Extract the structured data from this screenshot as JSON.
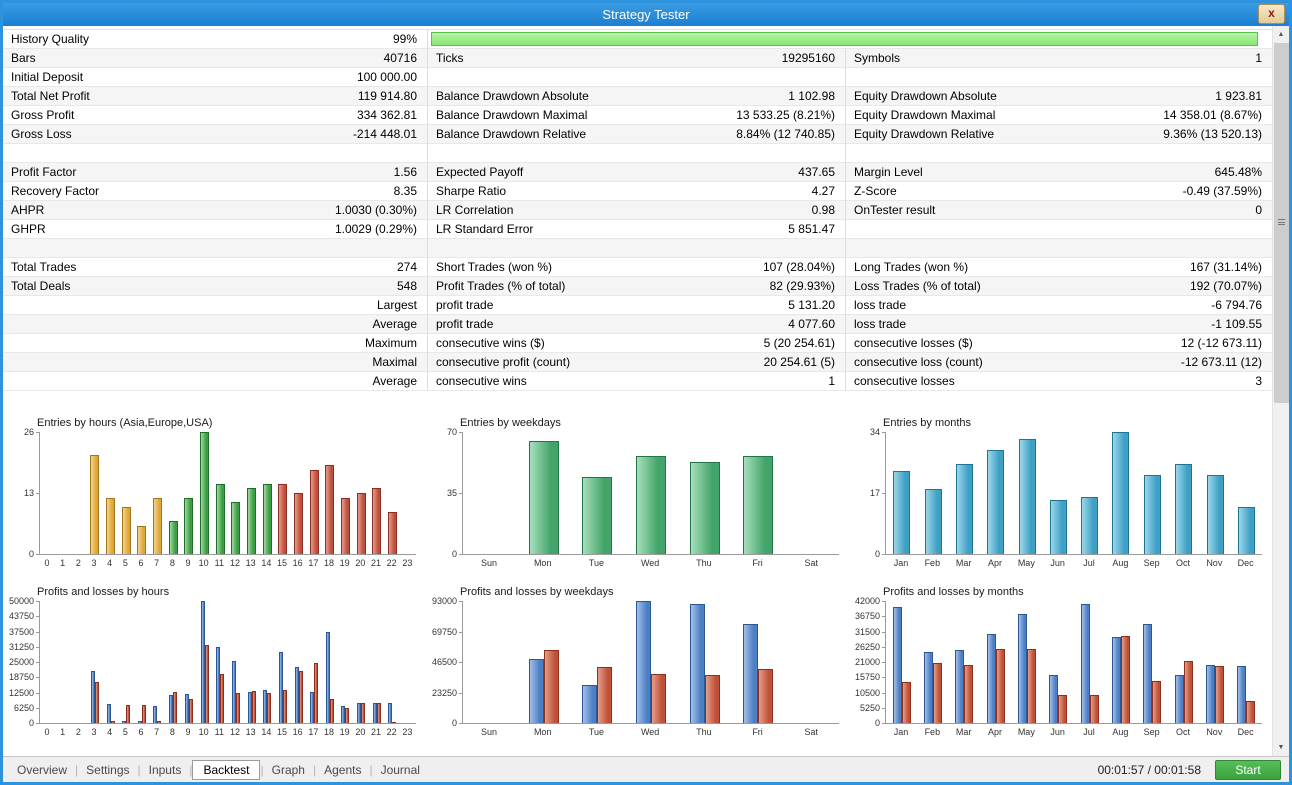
{
  "window": {
    "title": "Strategy Tester",
    "close_glyph": "x"
  },
  "scrollbar": {
    "up": "▲",
    "down": "▼"
  },
  "stats": {
    "rows": [
      {
        "cells": [
          "History Quality",
          "99%",
          "",
          "",
          "",
          ""
        ],
        "progress": 99
      },
      {
        "cells": [
          "Bars",
          "40716",
          "Ticks",
          "19295160",
          "Symbols",
          "1"
        ]
      },
      {
        "cells": [
          "Initial Deposit",
          "100 000.00",
          "",
          "",
          "",
          ""
        ]
      },
      {
        "cells": [
          "Total Net Profit",
          "119 914.80",
          "Balance Drawdown Absolute",
          "1 102.98",
          "Equity Drawdown Absolute",
          "1 923.81"
        ]
      },
      {
        "cells": [
          "Gross Profit",
          "334 362.81",
          "Balance Drawdown Maximal",
          "13 533.25 (8.21%)",
          "Equity Drawdown Maximal",
          "14 358.01 (8.67%)"
        ]
      },
      {
        "cells": [
          "Gross Loss",
          "-214 448.01",
          "Balance Drawdown Relative",
          "8.84% (12 740.85)",
          "Equity Drawdown Relative",
          "9.36% (13 520.13)"
        ]
      },
      {
        "cells": [
          "",
          "",
          "",
          "",
          "",
          ""
        ]
      },
      {
        "cells": [
          "Profit Factor",
          "1.56",
          "Expected Payoff",
          "437.65",
          "Margin Level",
          "645.48%"
        ]
      },
      {
        "cells": [
          "Recovery Factor",
          "8.35",
          "Sharpe Ratio",
          "4.27",
          "Z-Score",
          "-0.49 (37.59%)"
        ]
      },
      {
        "cells": [
          "AHPR",
          "1.0030 (0.30%)",
          "LR Correlation",
          "0.98",
          "OnTester result",
          "0"
        ]
      },
      {
        "cells": [
          "GHPR",
          "1.0029 (0.29%)",
          "LR Standard Error",
          "5 851.47",
          "",
          ""
        ]
      },
      {
        "cells": [
          "",
          "",
          "",
          "",
          "",
          ""
        ]
      },
      {
        "cells": [
          "Total Trades",
          "274",
          "Short Trades (won %)",
          "107 (28.04%)",
          "Long Trades (won %)",
          "167 (31.14%)"
        ]
      },
      {
        "cells": [
          "Total Deals",
          "548",
          "Profit Trades (% of total)",
          "82 (29.93%)",
          "Loss Trades (% of total)",
          "192 (70.07%)"
        ]
      },
      {
        "cells": [
          "",
          "Largest",
          "profit trade",
          "5 131.20",
          "loss trade",
          "-6 794.76"
        ]
      },
      {
        "cells": [
          "",
          "Average",
          "profit trade",
          "4 077.60",
          "loss trade",
          "-1 109.55"
        ]
      },
      {
        "cells": [
          "",
          "Maximum",
          "consecutive wins ($)",
          "5 (20 254.61)",
          "consecutive losses ($)",
          "12 (-12 673.11)"
        ]
      },
      {
        "cells": [
          "",
          "Maximal",
          "consecutive profit (count)",
          "20 254.61 (5)",
          "consecutive loss (count)",
          "-12 673.11 (12)"
        ]
      },
      {
        "cells": [
          "",
          "Average",
          "consecutive wins",
          "1",
          "consecutive losses",
          "3"
        ]
      }
    ]
  },
  "palette": {
    "asia": {
      "base": "#dfa63a",
      "light": "#f3d38e",
      "dark": "#a3761c"
    },
    "europe": {
      "base": "#3c9d44",
      "light": "#9fd9a0",
      "dark": "#1f6f28"
    },
    "usa": {
      "base": "#bf4f3c",
      "light": "#e39c8c",
      "dark": "#8c2f20"
    },
    "green": {
      "base": "#43a469",
      "light": "#a7dfbb",
      "dark": "#23744a"
    },
    "blue": {
      "base": "#3ea0c6",
      "light": "#9bd7e8",
      "dark": "#1f7494"
    },
    "profit": {
      "base": "#4d7fc4",
      "light": "#a3bfe8",
      "dark": "#2c5795"
    },
    "loss": {
      "base": "#c05138",
      "light": "#e49e8a",
      "dark": "#8e2f1c"
    }
  },
  "chart_data": [
    {
      "type": "bar",
      "title": "Entries by hours (Asia,Europe,USA)",
      "categories": [
        "0",
        "1",
        "2",
        "3",
        "4",
        "5",
        "6",
        "7",
        "8",
        "9",
        "10",
        "11",
        "12",
        "13",
        "14",
        "15",
        "16",
        "17",
        "18",
        "19",
        "20",
        "21",
        "22",
        "23"
      ],
      "values": [
        0,
        0,
        0,
        21,
        12,
        10,
        6,
        12,
        7,
        12,
        26,
        15,
        11,
        14,
        15,
        15,
        13,
        18,
        19,
        12,
        13,
        14,
        9,
        0
      ],
      "bar_colors": [
        "",
        "",
        "",
        "asia",
        "asia",
        "asia",
        "asia",
        "asia",
        "europe",
        "europe",
        "europe",
        "europe",
        "europe",
        "europe",
        "europe",
        "usa",
        "usa",
        "usa",
        "usa",
        "usa",
        "usa",
        "usa",
        "usa",
        ""
      ],
      "yticks": [
        0,
        13,
        26
      ],
      "ylim": [
        0,
        26
      ],
      "xlabel": "",
      "ylabel": ""
    },
    {
      "type": "bar",
      "title": "Entries by weekdays",
      "categories": [
        "Sun",
        "Mon",
        "Tue",
        "Wed",
        "Thu",
        "Fri",
        "Sat"
      ],
      "values": [
        0,
        65,
        44,
        56,
        53,
        56,
        0
      ],
      "color": "green",
      "yticks": [
        0,
        35,
        70
      ],
      "ylim": [
        0,
        70
      ],
      "xlabel": "",
      "ylabel": ""
    },
    {
      "type": "bar",
      "title": "Entries by months",
      "categories": [
        "Jan",
        "Feb",
        "Mar",
        "Apr",
        "May",
        "Jun",
        "Jul",
        "Aug",
        "Sep",
        "Oct",
        "Nov",
        "Dec"
      ],
      "values": [
        23,
        18,
        25,
        29,
        32,
        15,
        16,
        34,
        22,
        25,
        22,
        13
      ],
      "color": "blue",
      "yticks": [
        0,
        17,
        34
      ],
      "ylim": [
        0,
        34
      ],
      "xlabel": "",
      "ylabel": ""
    },
    {
      "type": "bar",
      "title": "Profits and losses by hours",
      "categories": [
        "0",
        "1",
        "2",
        "3",
        "4",
        "5",
        "6",
        "7",
        "8",
        "9",
        "10",
        "11",
        "12",
        "13",
        "14",
        "15",
        "16",
        "17",
        "18",
        "19",
        "20",
        "21",
        "22",
        "23"
      ],
      "series": [
        {
          "name": "profit",
          "color": "profit",
          "values": [
            0,
            0,
            0,
            21500,
            7600,
            900,
            900,
            7000,
            11500,
            12000,
            50000,
            31300,
            25400,
            12800,
            13500,
            28900,
            22900,
            12900,
            37300,
            7000,
            8100,
            8200,
            8300,
            0
          ]
        },
        {
          "name": "loss",
          "color": "loss",
          "values": [
            0,
            0,
            0,
            16800,
            900,
            7300,
            7300,
            900,
            12500,
            10000,
            31800,
            19900,
            12100,
            13000,
            12400,
            13400,
            21400,
            24400,
            9800,
            6200,
            8000,
            8100,
            500,
            0
          ]
        }
      ],
      "yticks": [
        0,
        6250,
        12500,
        18750,
        25000,
        31250,
        37500,
        43750,
        50000
      ],
      "ylim": [
        0,
        50000
      ],
      "xlabel": "",
      "ylabel": ""
    },
    {
      "type": "bar",
      "title": "Profits and losses by weekdays",
      "categories": [
        "Sun",
        "Mon",
        "Tue",
        "Wed",
        "Thu",
        "Fri",
        "Sat"
      ],
      "series": [
        {
          "name": "profit",
          "color": "profit",
          "values": [
            0,
            48500,
            29000,
            93000,
            90500,
            75500,
            0
          ]
        },
        {
          "name": "loss",
          "color": "loss",
          "values": [
            0,
            56000,
            43000,
            37500,
            36500,
            41500,
            0
          ]
        }
      ],
      "yticks": [
        0,
        23250,
        46500,
        69750,
        93000
      ],
      "ylim": [
        0,
        93000
      ],
      "xlabel": "",
      "ylabel": ""
    },
    {
      "type": "bar",
      "title": "Profits and losses by months",
      "categories": [
        "Jan",
        "Feb",
        "Mar",
        "Apr",
        "May",
        "Jun",
        "Jul",
        "Aug",
        "Sep",
        "Oct",
        "Nov",
        "Dec"
      ],
      "series": [
        {
          "name": "profit",
          "color": "profit",
          "values": [
            40000,
            24500,
            25000,
            30500,
            37500,
            16500,
            41000,
            29500,
            34000,
            16500,
            20000,
            19500
          ]
        },
        {
          "name": "loss",
          "color": "loss",
          "values": [
            14000,
            20500,
            20000,
            25500,
            25500,
            9500,
            9500,
            30000,
            14500,
            21500,
            19500,
            7500
          ]
        }
      ],
      "yticks": [
        0,
        5250,
        10500,
        15750,
        21000,
        26250,
        31500,
        36750,
        42000
      ],
      "ylim": [
        0,
        42000
      ],
      "xlabel": "",
      "ylabel": ""
    }
  ],
  "tabs": {
    "items": [
      "Overview",
      "Settings",
      "Inputs",
      "Backtest",
      "Graph",
      "Agents",
      "Journal"
    ],
    "active": "Backtest",
    "separator": "|"
  },
  "statusbar": {
    "time": "00:01:57 / 00:01:58",
    "start_label": "Start"
  }
}
